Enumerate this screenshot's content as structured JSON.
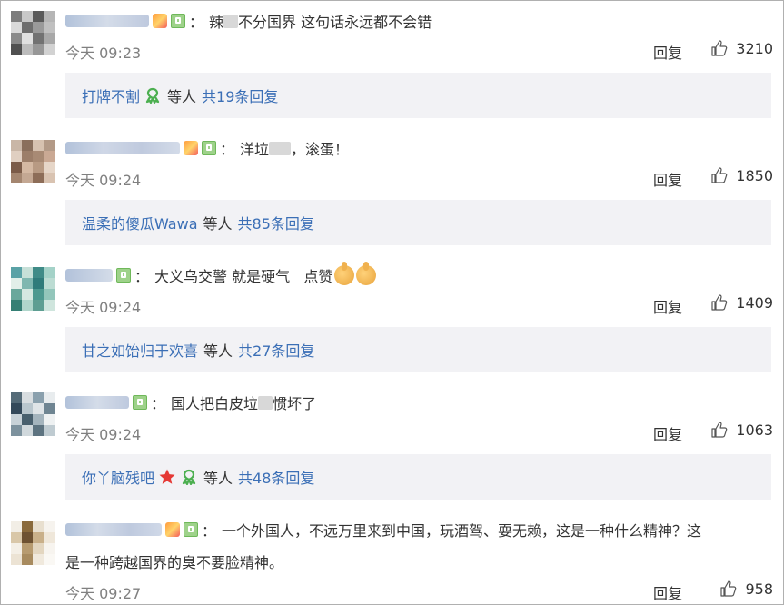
{
  "comments": [
    {
      "avatar_colors": [
        "#7d7d7d",
        "#c8c8c8",
        "#5a5a5a",
        "#b5b5b5",
        "#d9d9d9",
        "#6e6e6e",
        "#9a9a9a",
        "#c0c0c0",
        "#8a8a8a",
        "#e0e0e0",
        "#727272",
        "#a8a8a8",
        "#505050",
        "#bcbcbc",
        "#979797",
        "#d2d2d2"
      ],
      "text_before": "辣",
      "text_after": "不分国界 这句话永远都不会错",
      "time": "今天 09:23",
      "reply_label": "回复",
      "likes": "3210",
      "reply_user": "打牌不割",
      "reply_mid": "等人",
      "reply_count": "共19条回复"
    },
    {
      "avatar_colors": [
        "#c9b6a6",
        "#8a6f5c",
        "#d7c2b0",
        "#b39a87",
        "#e0cfc1",
        "#9c7e69",
        "#a88a74",
        "#caa994",
        "#7b5b48",
        "#d4b8a2",
        "#b89a83",
        "#e6d6c8",
        "#a48670",
        "#c4a893",
        "#8d6d58",
        "#d9c3b1"
      ],
      "text_before": "洋垃",
      "text_after": "，滚蛋！",
      "time": "今天 09:24",
      "reply_label": "回复",
      "likes": "1850",
      "reply_user": "温柔的傻瓜Wawa",
      "reply_mid": "等人",
      "reply_count": "共85条回复"
    },
    {
      "avatar_colors": [
        "#5aa2a6",
        "#c7e0d8",
        "#3f8b87",
        "#a4d2c8",
        "#e2efe9",
        "#7fb7b0",
        "#2f7b7a",
        "#bcdcd3",
        "#6aa89c",
        "#d5e8e1",
        "#4d9990",
        "#93c6bb",
        "#357f74",
        "#b0d6cb",
        "#5e9e92",
        "#cfe5dd"
      ],
      "text": "大义乌交警 就是硬气   点赞",
      "time": "今天 09:24",
      "reply_label": "回复",
      "likes": "1409",
      "reply_user": "甘之如饴归于欢喜",
      "reply_mid": "等人",
      "reply_count": "共27条回复"
    },
    {
      "avatar_colors": [
        "#556b78",
        "#d8dde0",
        "#8aa0ad",
        "#e8ecee",
        "#34495a",
        "#b9c6cd",
        "#dfe4e7",
        "#6f8592",
        "#c8d2d8",
        "#49606e",
        "#a4b4bd",
        "#eef1f2",
        "#7d929e",
        "#d0d8dc",
        "#5d7380",
        "#bfcbd1"
      ],
      "text_before": "国人把白皮垃",
      "text_after": "惯坏了",
      "time": "今天 09:24",
      "reply_label": "回复",
      "likes": "1063",
      "reply_user": "你丫脑残吧",
      "reply_mid": "等人",
      "reply_count": "共48条回复"
    },
    {
      "avatar_colors": [
        "#f2eee6",
        "#8a6a3c",
        "#e8dfcf",
        "#f6f3ee",
        "#d9c7a8",
        "#6e5232",
        "#c9b08a",
        "#efe7da",
        "#f4efe6",
        "#b79b70",
        "#e3d6c0",
        "#f7f4ef",
        "#ece3d4",
        "#a88b5f",
        "#f0e9dd",
        "#faf8f4"
      ],
      "text_line1": "一个外国人，不远万里来到中国，玩酒驾、耍无赖，这是一种什么精神？这",
      "text_line2": "是一种跨越国界的臭不要脸精神。",
      "time": "今天 09:27",
      "reply_label": "回复",
      "likes": "958"
    }
  ]
}
